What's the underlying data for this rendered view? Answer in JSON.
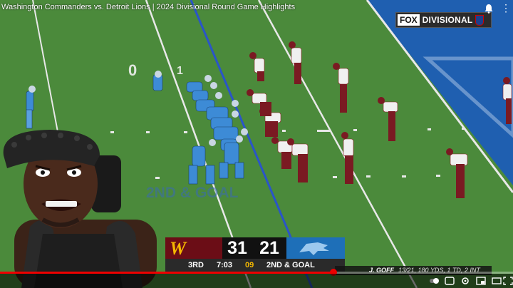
{
  "video": {
    "title": "Washington Commanders vs. Detroit Lions | 2024 Divisional Round Game Highlights",
    "progress": 0.65
  },
  "broadcast": {
    "network": "FOX",
    "round": "DIVISIONAL"
  },
  "field": {
    "yard_marker_left": "0",
    "yard_marker_right": "1",
    "endzone_text": "2ND & GOAL"
  },
  "scorebug": {
    "away_logo_letter": "W",
    "away_score": "31",
    "home_score": "21",
    "quarter": "3RD",
    "clock": "7:03",
    "play_clock": "09",
    "down_distance": "2ND & GOAL"
  },
  "stat": {
    "player": "J. GOFF",
    "line": "13/21, 180 YDS, 1 TD, 2 INT"
  },
  "colors": {
    "field_green": "#4b8a3b",
    "endzone_blue": "#1f5fb0",
    "lions_blue": "#3d8bd6",
    "commanders_burgundy": "#6b0d16",
    "commanders_gold": "#f5b800",
    "progress_red": "#e00000"
  },
  "icons": {
    "bell": "bell-icon",
    "menu": "more-vert-icon"
  }
}
